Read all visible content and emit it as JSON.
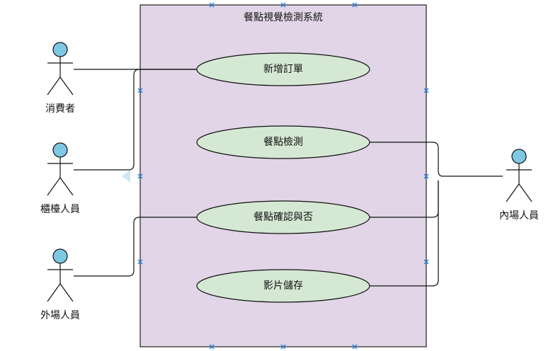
{
  "system": {
    "title": "餐點視覺檢測系統",
    "fill_color": "#e1d5e7",
    "border_color": "#222222"
  },
  "colors": {
    "usecase_fill": "#d5e8d4",
    "actor_head": "#7ec8e3",
    "line": "#111111",
    "handle": "#2a7be4"
  },
  "actors": [
    {
      "id": "consumer",
      "label": "消費者"
    },
    {
      "id": "counter",
      "label": "櫃檯人員"
    },
    {
      "id": "floor",
      "label": "外場人員"
    },
    {
      "id": "kitchen",
      "label": "內場人員"
    }
  ],
  "use_cases": [
    {
      "id": "add-order",
      "label": "新增訂單"
    },
    {
      "id": "meal-detect",
      "label": "餐點檢測"
    },
    {
      "id": "meal-confirm",
      "label": "餐點確認與否"
    },
    {
      "id": "video-store",
      "label": "影片儲存"
    }
  ]
}
